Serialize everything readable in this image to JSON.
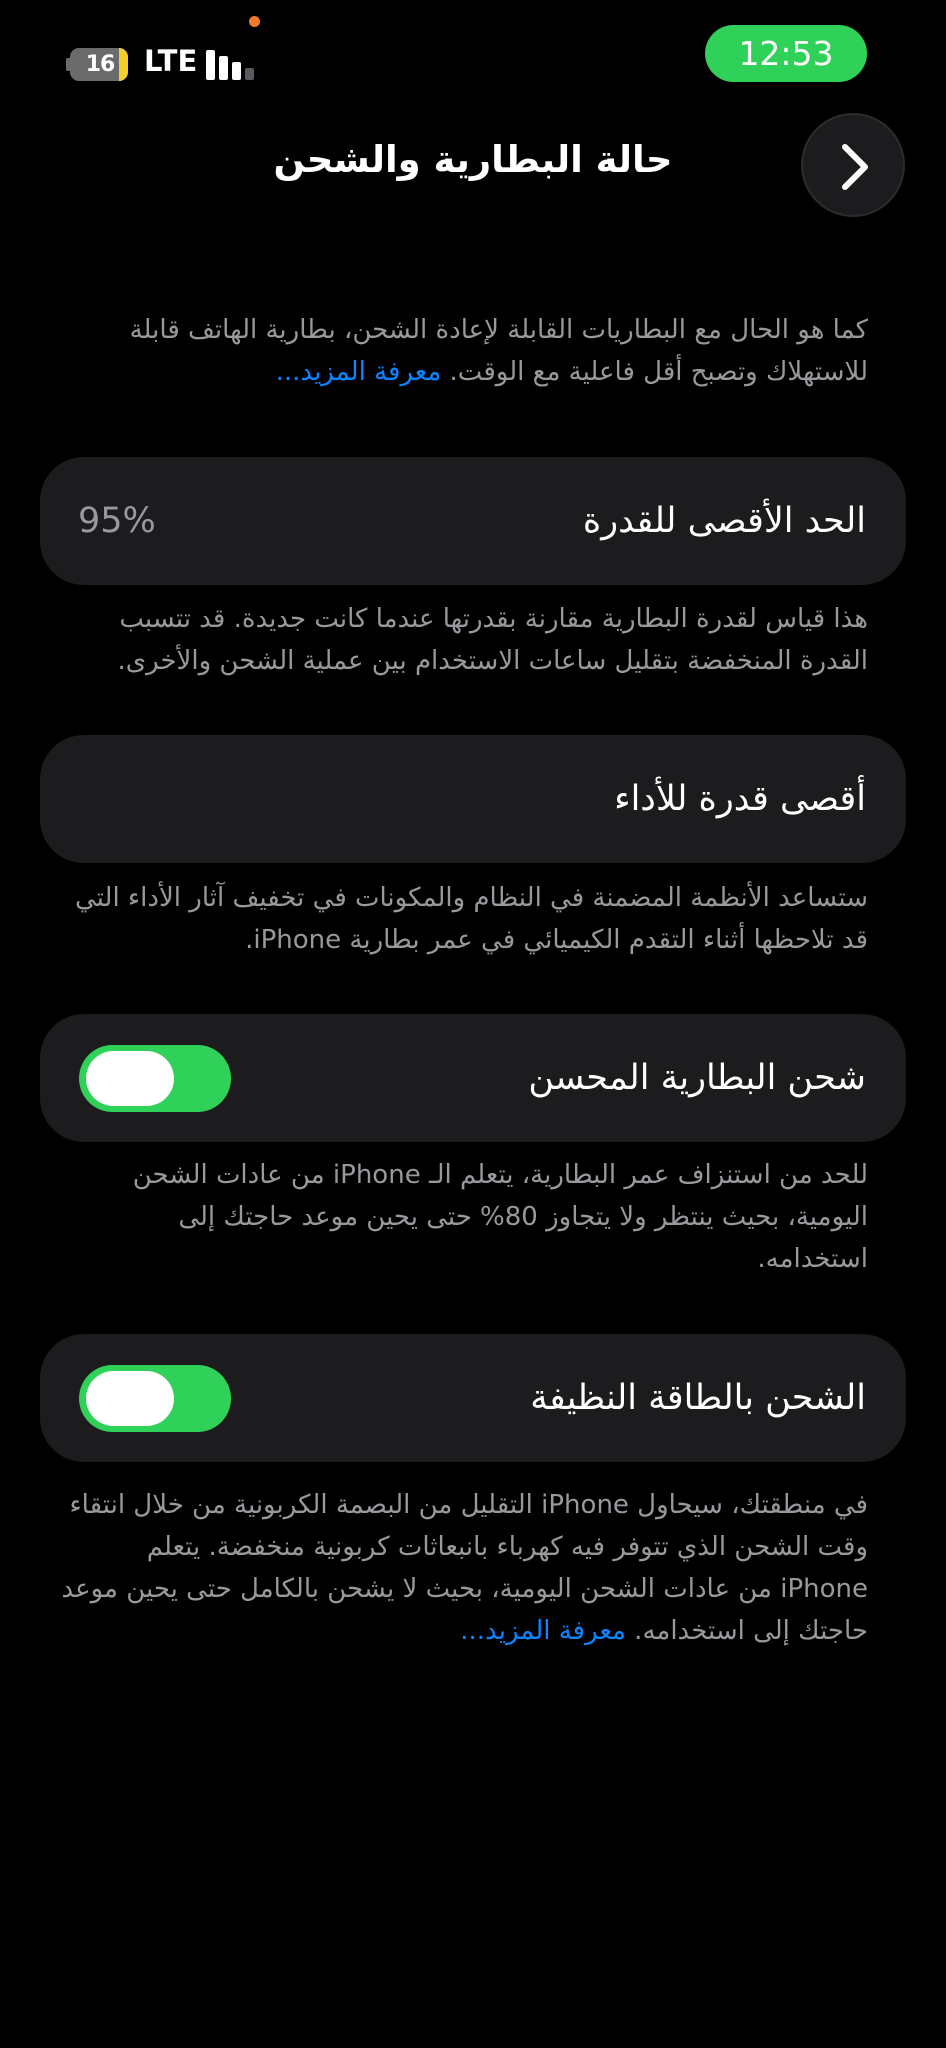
{
  "status_bar": {
    "battery_level": "16",
    "battery_fraction": 0.16,
    "network": "LTE",
    "signal_bars": 3,
    "time": "12:53"
  },
  "header": {
    "title": "حالة البطارية والشحن"
  },
  "intro": {
    "text": "كما هو الحال مع البطاريات القابلة لإعادة الشحن، بطارية الهاتف قابلة للاستهلاك وتصبح أقل فاعلية مع الوقت. ",
    "link": "معرفة المزيد..."
  },
  "max_capacity": {
    "label": "الحد الأقصى للقدرة",
    "value": "95%",
    "description": "هذا قياس لقدرة البطارية مقارنة بقدرتها عندما كانت جديدة. قد تتسبب القدرة المنخفضة بتقليل ساعات الاستخدام بين عملية الشحن والأخرى."
  },
  "peak_performance": {
    "label": "أقصى قدرة للأداء",
    "description": "ستساعد الأنظمة المضمنة في النظام والمكونات في تخفيف آثار الأداء التي قد تلاحظها أثناء التقدم الكيميائي في عمر بطارية iPhone."
  },
  "optimized_charging": {
    "label": "شحن البطارية المحسن",
    "enabled": true,
    "description": "للحد من استنزاف عمر البطارية، يتعلم الـ iPhone من عادات الشحن اليومية، بحيث ينتظر ولا يتجاوز 80% حتى يحين موعد حاجتك إلى استخدامه."
  },
  "clean_energy": {
    "label": "الشحن بالطاقة النظيفة",
    "enabled": true,
    "description": "في منطقتك، سيحاول iPhone التقليل من البصمة الكربونية من خلال انتقاء وقت الشحن الذي تتوفر فيه كهرباء بانبعاثات كربونية منخفضة. يتعلم iPhone من عادات الشحن اليومية، بحيث لا يشحن بالكامل حتى يحين موعد حاجتك إلى استخدامه. ",
    "link": "معرفة المزيد..."
  },
  "colors": {
    "background": "#000000",
    "card": "#1c1c1e",
    "accent_green": "#30d158",
    "link_blue": "#0a84ff",
    "secondary_text": "#98989d"
  },
  "icons": {
    "back": "chevron-right-icon",
    "battery": "battery-icon",
    "signal": "signal-bars-icon"
  }
}
